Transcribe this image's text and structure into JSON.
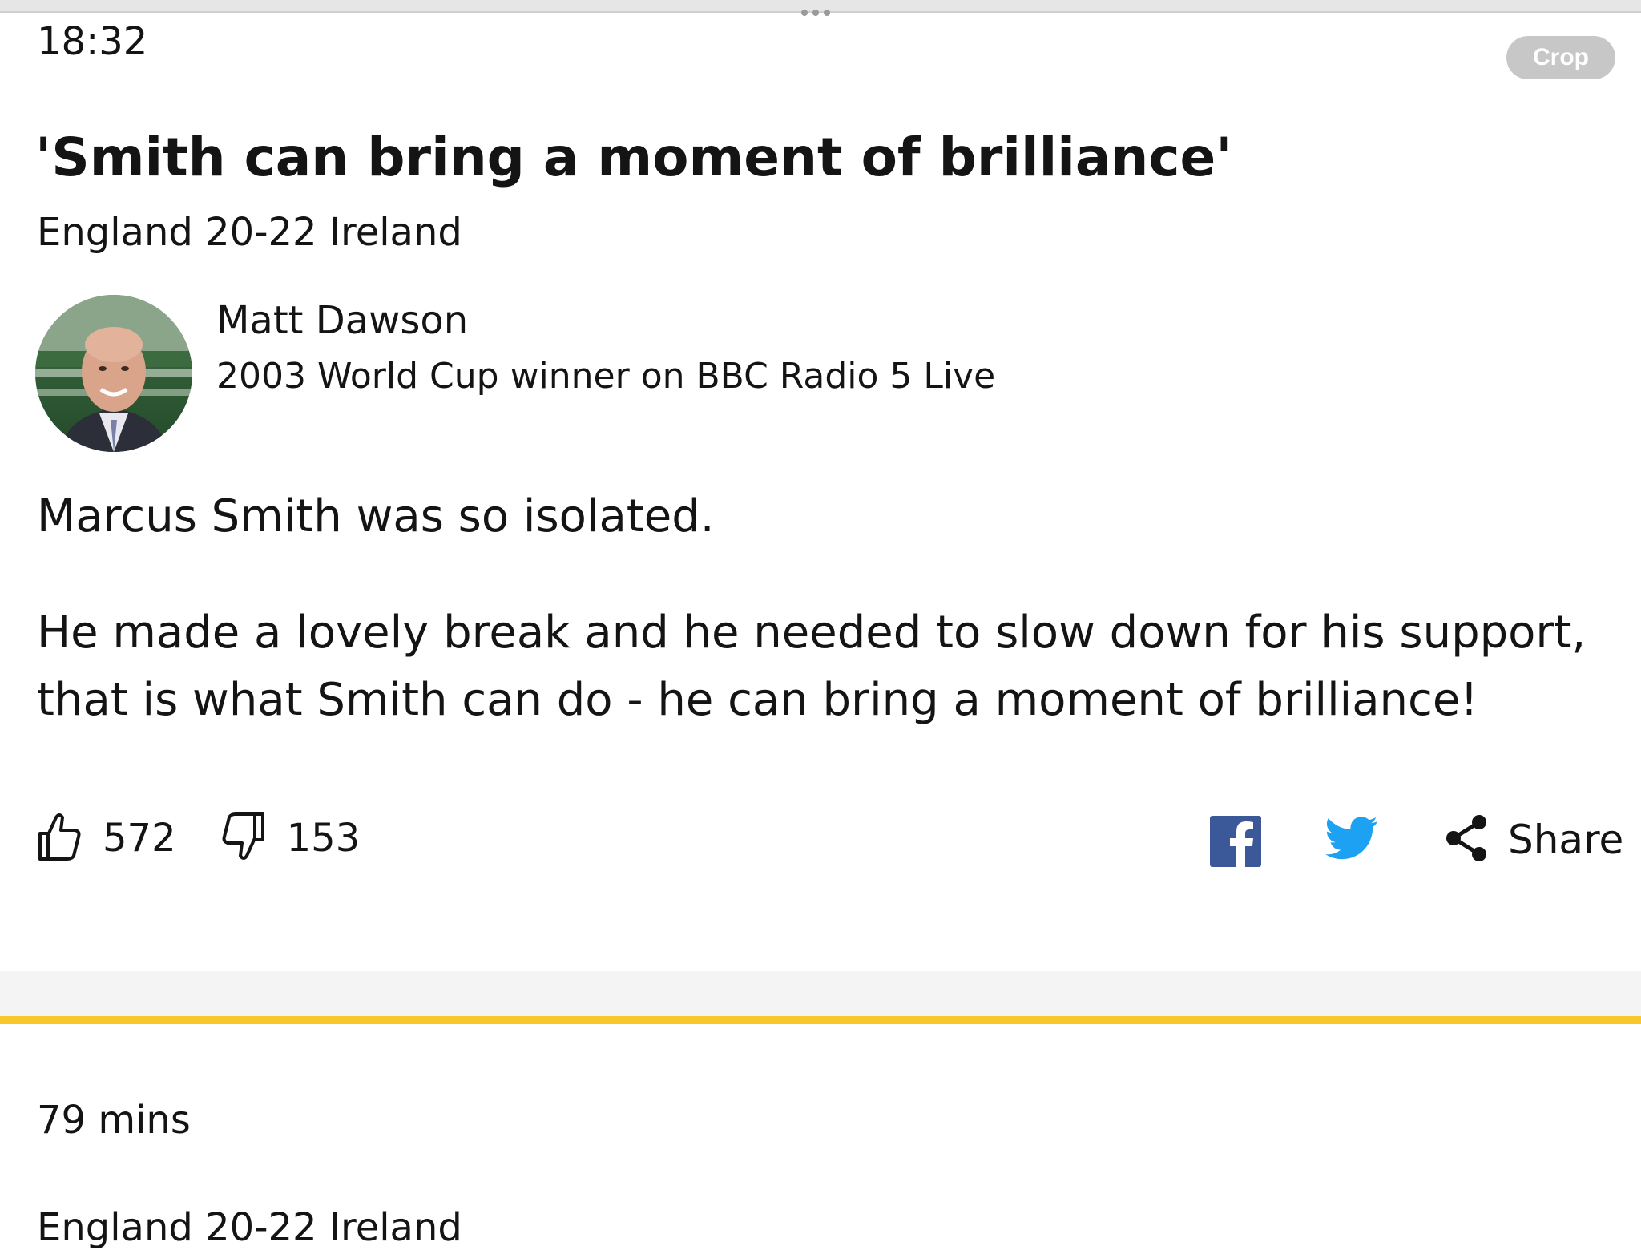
{
  "entry": {
    "time": "18:32",
    "crop_label": "Crop",
    "headline": "'Smith can bring a moment of brilliance'",
    "subline": "England 20-22 Ireland",
    "contributor": {
      "name": "Matt Dawson",
      "role": "2003 World Cup winner on BBC Radio 5 Live"
    },
    "paragraphs": [
      "Marcus Smith was so isolated.",
      "He made a lovely break and he needed to slow down for his support, that is what Smith can do - he can bring a moment of brilliance!"
    ],
    "reactions": {
      "likes": "572",
      "dislikes": "153"
    },
    "share_label": "Share"
  },
  "next_entry": {
    "time": "79 mins",
    "subline": "England 20-22 Ireland"
  },
  "colors": {
    "accent_yellow": "#f8c82a",
    "facebook": "#3b5998",
    "twitter": "#1da1f2",
    "crop_button": "#c7c7c7"
  }
}
